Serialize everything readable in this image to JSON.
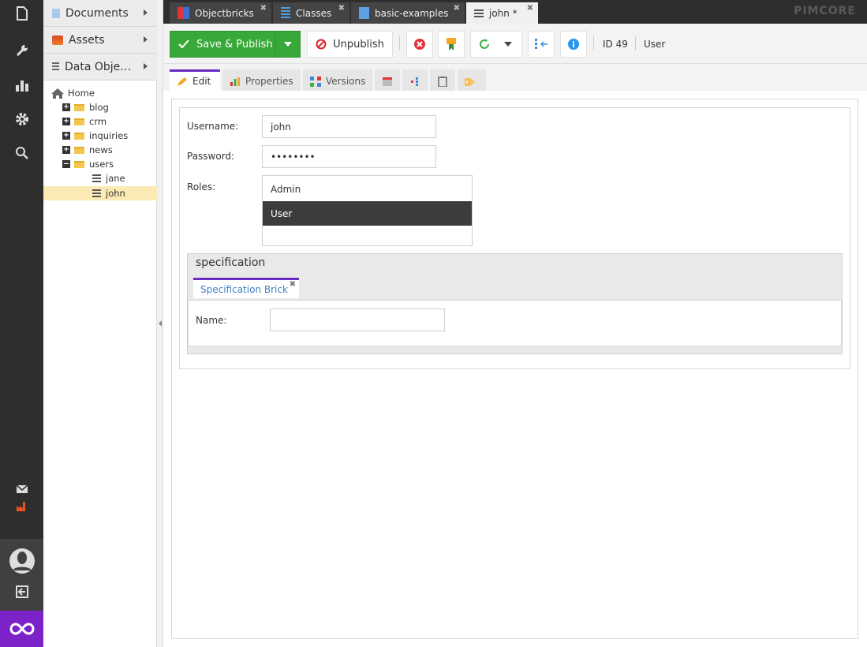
{
  "app": {
    "logo": "PIMCORE"
  },
  "tree_panel": {
    "accordion": [
      {
        "label": "Documents",
        "icon": "document-icon"
      },
      {
        "label": "Assets",
        "icon": "image-icon"
      },
      {
        "label": "Data Obje…",
        "icon": "list-icon"
      }
    ],
    "nodes": {
      "home": "Home",
      "blog": "blog",
      "crm": "crm",
      "inquiries": "inquiries",
      "news": "news",
      "users": "users",
      "jane": "jane",
      "john": "john"
    },
    "selected": "john"
  },
  "tabs": [
    {
      "label": "Objectbricks",
      "close": "✖"
    },
    {
      "label": "Classes",
      "close": "✖"
    },
    {
      "label": "basic-examples",
      "close": "✖"
    },
    {
      "label": "john *",
      "close": "✖",
      "active": true
    }
  ],
  "toolbar": {
    "save_publish": "Save & Publish",
    "unpublish": "Unpublish",
    "id_text": "ID 49",
    "class_text": "User"
  },
  "subtabs": {
    "edit": "Edit",
    "properties": "Properties",
    "versions": "Versions"
  },
  "form": {
    "username_label": "Username:",
    "username_value": "john",
    "password_label": "Password:",
    "password_value": "••••••••",
    "roles_label": "Roles:",
    "roles_options": [
      "Admin",
      "User"
    ],
    "roles_selected": "User",
    "spec_title": "specification",
    "brick_tab": "Specification Brick",
    "brick_close": "✖",
    "name_label": "Name:",
    "name_value": ""
  },
  "colors": {
    "sidebar": "#2e2e2e",
    "brand": "#7b22c8",
    "save_green": "#38a838",
    "active_tab_accent": "#6a2bc2",
    "tree_selected": "#fbeab3"
  }
}
